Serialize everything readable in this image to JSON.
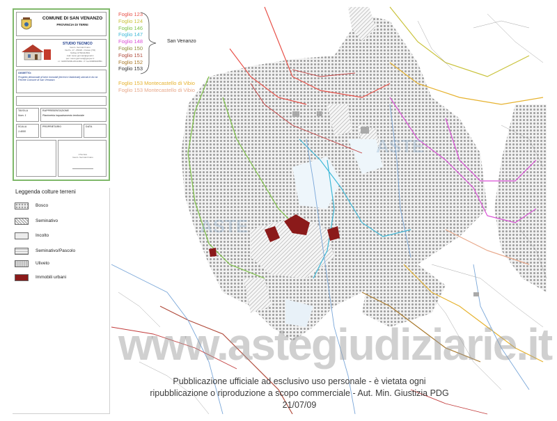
{
  "title_block": {
    "comune": "COMUNE DI SAN VENANZO",
    "provincia": "PROVINCIA DI TERNI",
    "studio_title": "STUDIO TECNICO",
    "studio_lines": [
      "Geom. Germani Ivano",
      "Via Po, 17 - 05018 - Orvieto (TR)",
      "Tel/Fax 0763/341564",
      "mail: ivano.germani@gmail.it",
      "pec: ivano.germani@geopec.it",
      "c.f. GRMVNI66L20G148H - P. iva 00686940551"
    ],
    "oggetto_label": "OGGETTO:",
    "oggetto_text": "Progetto divisionale di beni immobili (terreni e fabbricati) ubicati in loc.tà Felcete Comune di San Venanzo",
    "tavola_label": "TAVOLA",
    "tavola_value": "Num. 1",
    "rappresentazione_label": "RAPPRESENTAZIONE",
    "rappresentazione_value": "Planimetria inquadramento territoriale",
    "scala_label": "SCALA",
    "scala_value": "1:4000",
    "proprietario_label": "PROPRIETARIO",
    "data_label": "DATA",
    "firma_lines": [
      "Il Tecnico",
      "Geom. Germani Ivano"
    ]
  },
  "legend": {
    "title": "Leggenda colture terreni",
    "items": [
      {
        "label": "Bosco",
        "pattern": "bosco"
      },
      {
        "label": "Seminativo",
        "pattern": "seminativo"
      },
      {
        "label": "Incolto",
        "pattern": "incolto"
      },
      {
        "label": "Seminativo/Pascolo",
        "pattern": "pascolo"
      },
      {
        "label": "Uliveto",
        "pattern": "uliveto"
      },
      {
        "label": "Immobili urbani",
        "pattern": "urbani"
      }
    ]
  },
  "fogli": [
    {
      "label": "Foglio 123",
      "color": "#e8524a"
    },
    {
      "label": "Foglio 124",
      "color": "#c9c23a"
    },
    {
      "label": "Foglio 146",
      "color": "#7dc246"
    },
    {
      "label": "Foglio 147",
      "color": "#3fb9d8"
    },
    {
      "label": "Foglio 148",
      "color": "#d94fd6"
    },
    {
      "label": "Foglio 150",
      "color": "#8e8e3a"
    },
    {
      "label": "Foglio 151",
      "color": "#b04a3a"
    },
    {
      "label": "Foglio 152",
      "color": "#a8782a"
    },
    {
      "label": "Foglio 153",
      "color": "#333333"
    }
  ],
  "fogli_group_label": "San Venanzo",
  "montecastello": [
    {
      "label": "Foglio 153 Montecastello di Vibio",
      "color": "#e6b22e"
    },
    {
      "label": "Foglio 153 Montecastello di Vibio",
      "color": "#e8a88a"
    }
  ],
  "watermark": {
    "site": "www.astegiudiziarie.it",
    "mark": "ASTE",
    "notice_line1": "Pubblicazione ufficiale ad esclusivo uso personale - è vietata ogni",
    "notice_line2": "ripubblicazione o riproduzione a scopo commerciale - Aut. Min. Giustizia PDG 21/07/09"
  },
  "colors": {
    "frame_green": "#7fb86a",
    "parcel_red": "#8b1a1a",
    "river_blue": "#7aa7d9",
    "road_red": "#c23a3a"
  }
}
